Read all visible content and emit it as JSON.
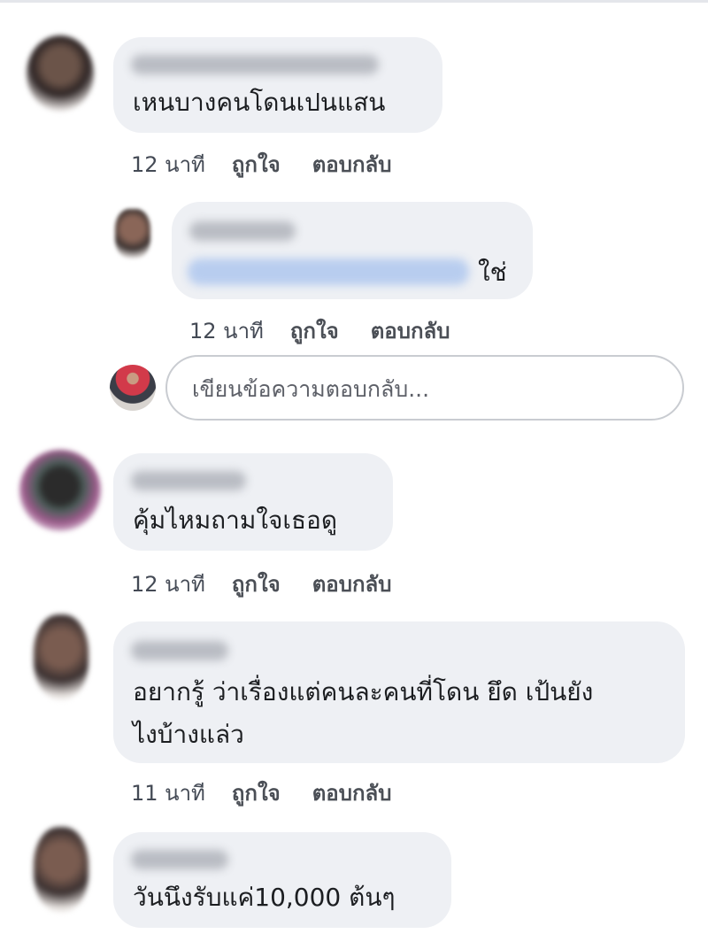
{
  "comments": [
    {
      "text": "เหนบางคนโดนเปนแสน",
      "time": "12 นาที",
      "like": "ถูกใจ",
      "reply": "ตอบกลับ",
      "replies": [
        {
          "text": "ใช่",
          "time": "12 นาที",
          "like": "ถูกใจ",
          "reply": "ตอบกลับ"
        }
      ]
    },
    {
      "text": "คุ้มไหมถามใจเธอดู",
      "time": "12 นาที",
      "like": "ถูกใจ",
      "reply": "ตอบกลับ"
    },
    {
      "text_line1": "อยากรู้ ว่าเรื่องแต่คนละคนที่โดน ยึด เป้นยัง",
      "text_line2": "ไงบ้างแล่ว",
      "time": "11 นาที",
      "like": "ถูกใจ",
      "reply": "ตอบกลับ"
    },
    {
      "text": "วันนึงรับแค่10,000 ต้นๆ"
    }
  ],
  "reply_box": {
    "placeholder": "เขียนข้อความตอบกลับ..."
  }
}
